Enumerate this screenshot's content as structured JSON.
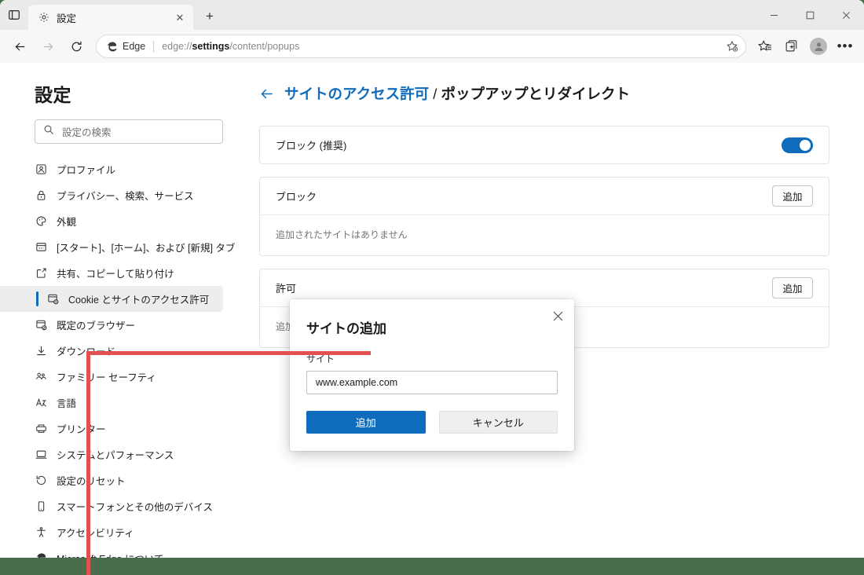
{
  "window": {
    "controls": {
      "minimize": "−",
      "maximize": "□",
      "close": "✕"
    }
  },
  "tabstrip": {
    "tab_search_icon": "tab-search-icon",
    "tab": {
      "title": "設定",
      "favicon_icon": "gear-icon",
      "close_label": "✕"
    },
    "new_tab_label": "+"
  },
  "toolbar": {
    "back_icon": "back-arrow-icon",
    "forward_icon": "forward-arrow-icon",
    "reload_icon": "reload-icon",
    "edge_label": "Edge",
    "url_prefix": "edge://",
    "url_bold": "settings",
    "url_suffix": "/content/popups",
    "add_favorite_icon": "add-favorite-star-icon",
    "favorites_icon": "favorites-list-icon",
    "collections_icon": "collections-icon",
    "profile_icon": "profile-avatar-icon",
    "settings_more_icon": "more-ellipsis-icon",
    "more_label": "•••"
  },
  "sidebar": {
    "title": "設定",
    "search": {
      "placeholder": "設定の検索",
      "icon": "search-icon"
    },
    "items": [
      {
        "label": "プロファイル",
        "icon": "profile-icon",
        "selected": false
      },
      {
        "label": "プライバシー、検索、サービス",
        "icon": "lock-icon",
        "selected": false
      },
      {
        "label": "外観",
        "icon": "palette-icon",
        "selected": false
      },
      {
        "label": "[スタート]、[ホーム]、および [新規] タブ",
        "icon": "start-home-newtab-icon",
        "selected": false
      },
      {
        "label": "共有、コピーして貼り付け",
        "icon": "share-icon",
        "selected": false
      },
      {
        "label": "Cookie とサイトのアクセス許可",
        "icon": "cookie-permissions-icon",
        "selected": true
      },
      {
        "label": "既定のブラウザー",
        "icon": "default-browser-icon",
        "selected": false
      },
      {
        "label": "ダウンロード",
        "icon": "download-icon",
        "selected": false
      },
      {
        "label": "ファミリー セーフティ",
        "icon": "family-safety-icon",
        "selected": false
      },
      {
        "label": "言語",
        "icon": "language-icon",
        "selected": false
      },
      {
        "label": "プリンター",
        "icon": "printer-icon",
        "selected": false
      },
      {
        "label": "システムとパフォーマンス",
        "icon": "system-performance-icon",
        "selected": false
      },
      {
        "label": "設定のリセット",
        "icon": "reset-icon",
        "selected": false
      },
      {
        "label": "スマートフォンとその他のデバイス",
        "icon": "phone-devices-icon",
        "selected": false
      },
      {
        "label": "アクセシビリティ",
        "icon": "accessibility-icon",
        "selected": false
      },
      {
        "label": "Microsoft Edge について",
        "icon": "edge-logo-icon",
        "selected": false
      }
    ]
  },
  "content": {
    "back_icon": "back-arrow-icon",
    "breadcrumb_parent": "サイトのアクセス許可",
    "breadcrumb_separator": " / ",
    "breadcrumb_current": "ポップアップとリダイレクト",
    "cards": [
      {
        "label": "ブロック (推奨)",
        "control": "toggle",
        "toggle_on": true
      },
      {
        "label": "ブロック",
        "control": "button",
        "button_label": "追加",
        "empty_text": "追加されたサイトはありません"
      },
      {
        "label": "許可",
        "control": "button",
        "button_label": "追加",
        "empty_text": "追加されたサイトはありません"
      }
    ]
  },
  "dialog": {
    "title": "サイトの追加",
    "close_label": "✕",
    "close_icon": "close-icon",
    "field_label": "サイト",
    "field_placeholder": "www.example.com",
    "field_value": "",
    "primary_label": "追加",
    "secondary_label": "キャンセル"
  },
  "colors": {
    "accent": "#0f6cbd",
    "annotation": "#e05252",
    "desktop": "#4a6e4c",
    "toolbar_bg": "#f7f7f7",
    "tabstrip_bg": "#eaeaea"
  }
}
